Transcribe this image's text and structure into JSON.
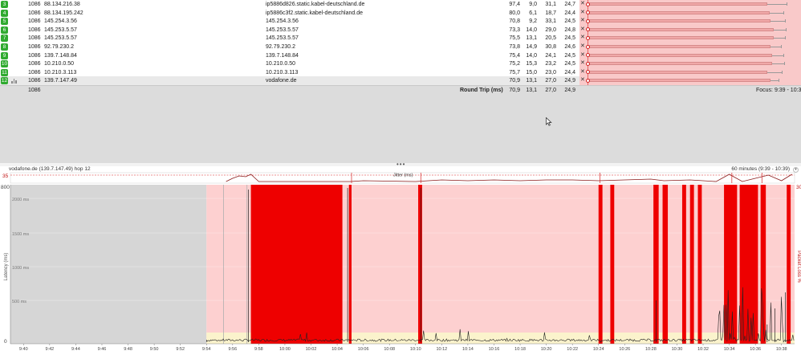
{
  "hops": [
    {
      "hop": "3",
      "count": "1086",
      "ip": "88.134.216.38",
      "name": "ip5886d826.static.kabel-deutschland.de",
      "avg": "97,4",
      "min": "9,0",
      "max": "31,1",
      "cur": "24,7"
    },
    {
      "hop": "4",
      "count": "1086",
      "ip": "88.134.195.242",
      "name": "ip5886c3f2.static.kabel-deutschland.de",
      "avg": "80,0",
      "min": "6,1",
      "max": "18,7",
      "cur": "24,4"
    },
    {
      "hop": "5",
      "count": "1086",
      "ip": "145.254.3.56",
      "name": "145.254.3.56",
      "avg": "70,8",
      "min": "9,2",
      "max": "33,1",
      "cur": "24,5"
    },
    {
      "hop": "6",
      "count": "1086",
      "ip": "145.253.5.57",
      "name": "145.253.5.57",
      "avg": "73,3",
      "min": "14,0",
      "max": "29,0",
      "cur": "24,8"
    },
    {
      "hop": "7",
      "count": "1086",
      "ip": "145.253.5.57",
      "name": "145.253.5.57",
      "avg": "75,5",
      "min": "13,1",
      "max": "20,5",
      "cur": "24,5"
    },
    {
      "hop": "8",
      "count": "1086",
      "ip": "92.79.230.2",
      "name": "92.79.230.2",
      "avg": "73,8",
      "min": "14,9",
      "max": "30,8",
      "cur": "24,6"
    },
    {
      "hop": "9",
      "count": "1086",
      "ip": "139.7.148.84",
      "name": "139.7.148.84",
      "avg": "75,4",
      "min": "14,0",
      "max": "24,1",
      "cur": "24,5"
    },
    {
      "hop": "10",
      "count": "1086",
      "ip": "10.210.0.50",
      "name": "10.210.0.50",
      "avg": "75,2",
      "min": "15,3",
      "max": "23,2",
      "cur": "24,5"
    },
    {
      "hop": "11",
      "count": "1086",
      "ip": "10.210.3.113",
      "name": "10.210.3.113",
      "avg": "75,7",
      "min": "15,0",
      "max": "23,0",
      "cur": "24,4"
    },
    {
      "hop": "12",
      "count": "1086",
      "ip": "139.7.147.49",
      "name": "vodafone.de",
      "avg": "70,9",
      "min": "13,1",
      "max": "27,0",
      "cur": "24,9"
    }
  ],
  "summary": {
    "count": "1086",
    "label": "Round Trip (ms)",
    "avg": "70,9",
    "min": "13,1",
    "max": "27,0",
    "cur": "24,9",
    "focus": "Focus: 9:39 - 10:3"
  },
  "chart": {
    "title": "vodafone.de (139.7.147.49) hop 12",
    "time_range": "60 minutes (9:39 - 10:39)",
    "jitter_label": "Jitter (ms)",
    "jitter_max": "35",
    "y_max_label": "800",
    "y_min_label": "0",
    "y_axis_title": "Latency (ms)",
    "right_axis_title": "Packet Loss %",
    "right_max_label": "30",
    "y_grid_labels": [
      "2000 ms",
      "1500 ms",
      "1000 ms",
      "500 ms"
    ],
    "x_ticks": [
      "9:40",
      "9:42",
      "9:44",
      "9:46",
      "9:48",
      "9:50",
      "9:52",
      "9:54",
      "9:56",
      "9:58",
      "10:00",
      "10:02",
      "10:04",
      "10:06",
      "10:08",
      "10:10",
      "10:12",
      "10:14",
      "10:16",
      "10:18",
      "10:20",
      "10:22",
      "10:24",
      "10:26",
      "10:28",
      "10:30",
      "10:32",
      "10:34",
      "10:36",
      "10:38"
    ],
    "colors": {
      "loss": "#ee0000",
      "monitored_bg": "#fdd0d0",
      "unmonitored_bg": "#d6d6d6",
      "good_band": "#fbf3cc",
      "latency_line": "#222222",
      "jitter_line": "#8b1a1a"
    }
  }
}
